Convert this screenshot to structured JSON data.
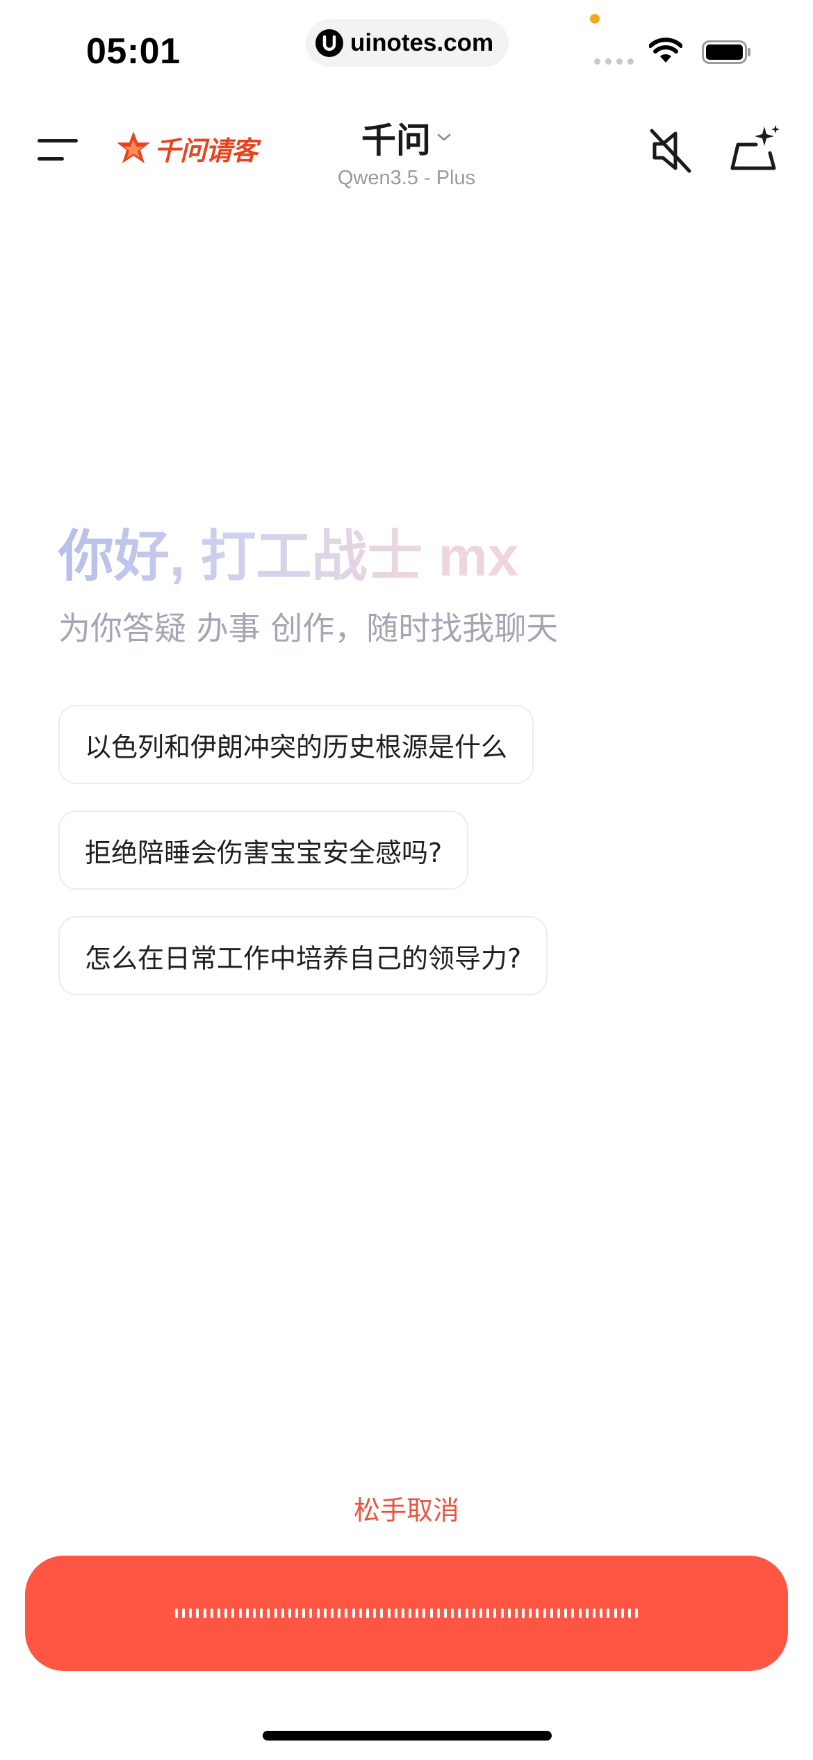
{
  "status_bar": {
    "time": "05:01",
    "url": "uinotes.com"
  },
  "header": {
    "brand": "千问请客",
    "model_name": "千问",
    "model_version": "Qwen3.5 - Plus"
  },
  "greeting": {
    "title": "你好, 打工战士 mx",
    "subtitle": "为你答疑 办事 创作，随时找我聊天"
  },
  "suggestions": [
    {
      "label": "以色列和伊朗冲突的历史根源是什么"
    },
    {
      "label": "拒绝陪睡会伤害宝宝安全感吗?"
    },
    {
      "label": "怎么在日常工作中培养自己的领导力?"
    }
  ],
  "voice": {
    "cancel_hint": "松手取消"
  },
  "colors": {
    "brand": "#e8431f",
    "record_bar": "#ff5543",
    "cancel_hint": "#e8543e"
  },
  "icons": {
    "menu": "menu-icon",
    "mute": "speaker-muted-icon",
    "new_chat": "sparkle-icon",
    "dropdown": "chevron-down-icon"
  }
}
